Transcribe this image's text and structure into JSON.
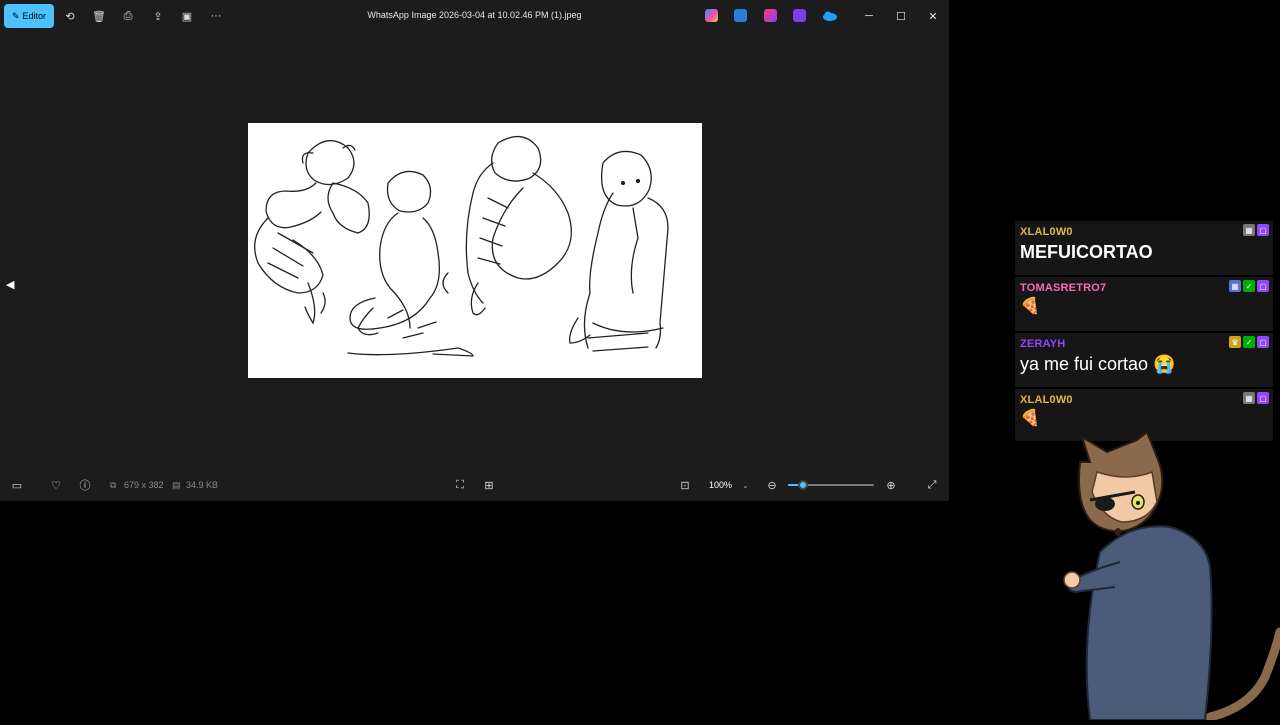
{
  "window": {
    "title": "WhatsApp Image 2026-03-04 at 10.02.46 PM (1).jpeg",
    "editor_label": "Editor"
  },
  "statusbar": {
    "dimensions": "679 x 382",
    "file_size": "34.9 KB",
    "zoom": "100%",
    "zoom_level": 0.18
  },
  "chat": {
    "messages": [
      {
        "user": "XLAL0W0",
        "color": "#e4b54a",
        "text": "MEFUICORTAO",
        "style": "big"
      },
      {
        "user": "TOMASRETRO7",
        "color": "#ff69b4",
        "text": "",
        "style": "emote"
      },
      {
        "user": "ZERAYH",
        "color": "#9146ff",
        "text": "ya me fui cortao 😭",
        "style": "med"
      },
      {
        "user": "XLAL0W0",
        "color": "#e4b54a",
        "text": "",
        "style": "emote"
      }
    ]
  },
  "colors": {
    "accent": "#4cc2ff",
    "twitch": "#9146ff"
  }
}
